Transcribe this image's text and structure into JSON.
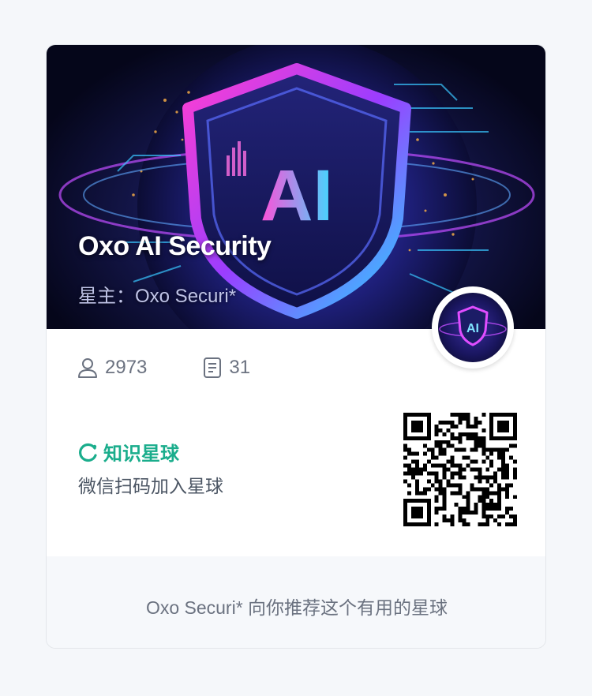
{
  "planet": {
    "title": "Oxo AI Security",
    "owner": "星主：Oxo Securi*",
    "banner_badge_text": "AI",
    "avatar_badge_text": "AI"
  },
  "stats": {
    "members_icon": "user-icon",
    "members": "2973",
    "posts_icon": "document-icon",
    "posts": "31"
  },
  "brand": {
    "icon": "zsxq-logo-icon",
    "name": "知识星球",
    "color": "#1aad8c"
  },
  "join_text": "微信扫码加入星球",
  "footer": {
    "text": "Oxo Securi* 向你推荐这个有用的星球"
  },
  "colors": {
    "accent": "#1aad8c",
    "footer_bg": "#f6f8fb",
    "text_secondary": "#6b7280"
  }
}
